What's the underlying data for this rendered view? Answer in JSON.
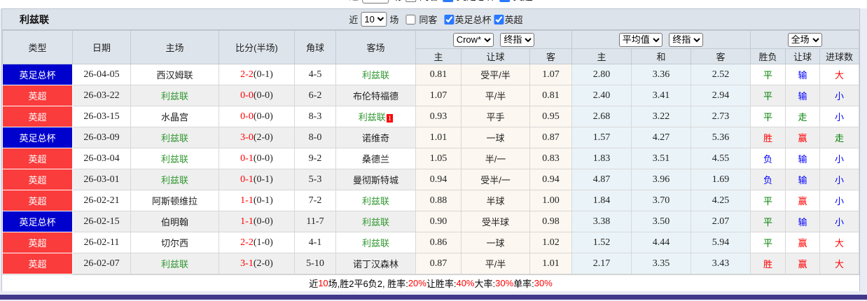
{
  "colors": {
    "league_blue": "#0101cd",
    "league_red": "#fa3c3c",
    "team_green": "#339933",
    "result_red": "#ff0000",
    "result_blue": "#0000ff",
    "result_green": "#008000",
    "odds_bg": "#fcf7f0",
    "avg_bg": "#eaf4f8",
    "bottom_bar": "#41388c"
  },
  "header": {
    "team_name": "利兹联",
    "filters": {
      "near_label": "近",
      "near_value": "10",
      "games_label": "场",
      "same_away": {
        "label": "同客",
        "checked": false
      },
      "fa_cup": {
        "label": "英足总杯",
        "checked": true
      },
      "epl": {
        "label": "英超",
        "checked": true
      }
    },
    "selects": {
      "company": "Crow*",
      "company_final": "终指",
      "average": "平均值",
      "average_final": "终指",
      "scope": "全场"
    }
  },
  "table": {
    "headers": {
      "type": "类型",
      "date": "日期",
      "home": "主场",
      "score": "比分(半场)",
      "corner": "角球",
      "away": "客场",
      "odds_home": "主",
      "odds_handicap": "让球",
      "odds_away": "客",
      "avg_home": "主",
      "avg_draw": "和",
      "avg_away": "客",
      "result_wdl": "胜负",
      "result_handicap": "让球",
      "result_goals": "进球数"
    }
  },
  "rows": [
    {
      "league": "英足总杯",
      "league_color": "blue",
      "date": "26-04-05",
      "home": "西汉姆联",
      "home_is_focus": false,
      "score": "2-2",
      "half": "(0-1)",
      "corner": "4-5",
      "away": "利兹联",
      "away_is_focus": true,
      "away_badge": "",
      "odds_home": "0.81",
      "handicap": "受平/半",
      "odds_away": "1.07",
      "avg_home": "2.80",
      "avg_draw": "3.36",
      "avg_away": "2.52",
      "wdl": {
        "t": "平",
        "c": "green"
      },
      "let": {
        "t": "输",
        "c": "blue"
      },
      "goals": {
        "t": "大",
        "c": "red"
      }
    },
    {
      "league": "英超",
      "league_color": "red",
      "date": "26-03-22",
      "home": "利兹联",
      "home_is_focus": true,
      "score": "0-0",
      "half": "(0-0)",
      "corner": "6-2",
      "away": "布伦特福德",
      "away_is_focus": false,
      "away_badge": "",
      "odds_home": "1.07",
      "handicap": "平/半",
      "odds_away": "0.81",
      "avg_home": "2.40",
      "avg_draw": "3.41",
      "avg_away": "2.94",
      "wdl": {
        "t": "平",
        "c": "green"
      },
      "let": {
        "t": "输",
        "c": "blue"
      },
      "goals": {
        "t": "小",
        "c": "blue"
      }
    },
    {
      "league": "英超",
      "league_color": "red",
      "date": "26-03-15",
      "home": "水晶宫",
      "home_is_focus": false,
      "score": "0-0",
      "half": "(0-0)",
      "corner": "8-3",
      "away": "利兹联",
      "away_is_focus": true,
      "away_badge": "1",
      "odds_home": "0.93",
      "handicap": "平手",
      "odds_away": "0.95",
      "avg_home": "2.68",
      "avg_draw": "3.22",
      "avg_away": "2.73",
      "wdl": {
        "t": "平",
        "c": "green"
      },
      "let": {
        "t": "走",
        "c": "green"
      },
      "goals": {
        "t": "小",
        "c": "blue"
      }
    },
    {
      "league": "英足总杯",
      "league_color": "blue",
      "date": "26-03-09",
      "home": "利兹联",
      "home_is_focus": true,
      "score": "3-0",
      "half": "(2-0)",
      "corner": "8-0",
      "away": "诺维奇",
      "away_is_focus": false,
      "away_badge": "",
      "odds_home": "1.01",
      "handicap": "一球",
      "odds_away": "0.87",
      "avg_home": "1.57",
      "avg_draw": "4.27",
      "avg_away": "5.36",
      "wdl": {
        "t": "胜",
        "c": "red"
      },
      "let": {
        "t": "赢",
        "c": "red"
      },
      "goals": {
        "t": "走",
        "c": "green"
      }
    },
    {
      "league": "英超",
      "league_color": "red",
      "date": "26-03-04",
      "home": "利兹联",
      "home_is_focus": true,
      "score": "0-1",
      "half": "(0-0)",
      "corner": "9-2",
      "away": "桑德兰",
      "away_is_focus": false,
      "away_badge": "",
      "odds_home": "1.05",
      "handicap": "半/一",
      "odds_away": "0.83",
      "avg_home": "1.83",
      "avg_draw": "3.51",
      "avg_away": "4.55",
      "wdl": {
        "t": "负",
        "c": "blue"
      },
      "let": {
        "t": "输",
        "c": "blue"
      },
      "goals": {
        "t": "小",
        "c": "blue"
      }
    },
    {
      "league": "英超",
      "league_color": "red",
      "date": "26-03-01",
      "home": "利兹联",
      "home_is_focus": true,
      "score": "0-1",
      "half": "(0-1)",
      "corner": "5-3",
      "away": "曼彻斯特城",
      "away_is_focus": false,
      "away_badge": "",
      "odds_home": "0.94",
      "handicap": "受半/一",
      "odds_away": "0.94",
      "avg_home": "4.87",
      "avg_draw": "3.96",
      "avg_away": "1.69",
      "wdl": {
        "t": "负",
        "c": "blue"
      },
      "let": {
        "t": "输",
        "c": "blue"
      },
      "goals": {
        "t": "小",
        "c": "blue"
      }
    },
    {
      "league": "英超",
      "league_color": "red",
      "date": "26-02-21",
      "home": "阿斯顿维拉",
      "home_is_focus": false,
      "score": "1-1",
      "half": "(0-1)",
      "corner": "7-2",
      "away": "利兹联",
      "away_is_focus": true,
      "away_badge": "",
      "odds_home": "0.88",
      "handicap": "半球",
      "odds_away": "1.00",
      "avg_home": "1.84",
      "avg_draw": "3.70",
      "avg_away": "4.25",
      "wdl": {
        "t": "平",
        "c": "green"
      },
      "let": {
        "t": "赢",
        "c": "red"
      },
      "goals": {
        "t": "小",
        "c": "blue"
      }
    },
    {
      "league": "英足总杯",
      "league_color": "blue",
      "date": "26-02-15",
      "home": "伯明翰",
      "home_is_focus": false,
      "score": "1-1",
      "half": "(0-0)",
      "corner": "11-7",
      "away": "利兹联",
      "away_is_focus": true,
      "away_badge": "",
      "odds_home": "0.90",
      "handicap": "受半球",
      "odds_away": "0.98",
      "avg_home": "3.38",
      "avg_draw": "3.50",
      "avg_away": "2.07",
      "wdl": {
        "t": "平",
        "c": "green"
      },
      "let": {
        "t": "输",
        "c": "blue"
      },
      "goals": {
        "t": "小",
        "c": "blue"
      }
    },
    {
      "league": "英超",
      "league_color": "red",
      "date": "26-02-11",
      "home": "切尔西",
      "home_is_focus": false,
      "score": "2-2",
      "half": "(1-0)",
      "corner": "4-1",
      "away": "利兹联",
      "away_is_focus": true,
      "away_badge": "",
      "odds_home": "0.86",
      "handicap": "一球",
      "odds_away": "1.02",
      "avg_home": "1.52",
      "avg_draw": "4.44",
      "avg_away": "5.94",
      "wdl": {
        "t": "平",
        "c": "green"
      },
      "let": {
        "t": "赢",
        "c": "red"
      },
      "goals": {
        "t": "大",
        "c": "red"
      }
    },
    {
      "league": "英超",
      "league_color": "red",
      "date": "26-02-07",
      "home": "利兹联",
      "home_is_focus": true,
      "score": "3-1",
      "half": "(2-0)",
      "corner": "5-10",
      "away": "诺丁汉森林",
      "away_is_focus": false,
      "away_badge": "",
      "odds_home": "0.87",
      "handicap": "平/半",
      "odds_away": "1.01",
      "avg_home": "2.17",
      "avg_draw": "3.35",
      "avg_away": "3.43",
      "wdl": {
        "t": "胜",
        "c": "red"
      },
      "let": {
        "t": "赢",
        "c": "red"
      },
      "goals": {
        "t": "大",
        "c": "red"
      }
    }
  ],
  "footer": {
    "segments": [
      {
        "t": "近",
        "c": "black"
      },
      {
        "t": "10",
        "c": "red"
      },
      {
        "t": "场,胜2平6负2, 胜率:",
        "c": "black"
      },
      {
        "t": "20%",
        "c": "red"
      },
      {
        "t": " 让胜率:",
        "c": "black"
      },
      {
        "t": "40%",
        "c": "red"
      },
      {
        "t": " 大率:",
        "c": "black"
      },
      {
        "t": "30%",
        "c": "red"
      },
      {
        "t": " 单率:",
        "c": "black"
      },
      {
        "t": "30%",
        "c": "red"
      }
    ]
  }
}
